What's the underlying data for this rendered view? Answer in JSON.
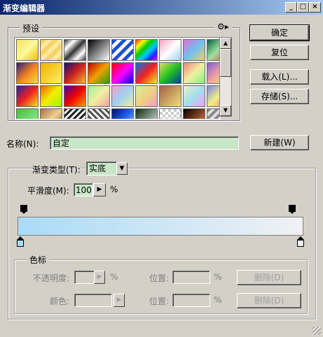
{
  "window": {
    "title": "渐变编辑器",
    "controls": [
      "_",
      "□",
      "×"
    ]
  },
  "buttons": {
    "ok": "确定",
    "reset": "复位",
    "load": "载入(L)...",
    "save": "存储(S)...",
    "new": "新建(W)",
    "delete_opacity": "删除(D)",
    "delete_color": "删除(D)"
  },
  "presets": {
    "label": "预设",
    "menu_icon": "gear-icon",
    "swatches": [
      "linear-gradient(135deg,#f3e35a,#fff7a0,#e8c400)",
      "repeating-linear-gradient(135deg,#f6d365 0 6px,#fde8a0 6px 12px)",
      "linear-gradient(135deg,#333,#fff,#333,#fff,#333)",
      "linear-gradient(135deg,#000,#fff)",
      "repeating-linear-gradient(135deg,#1e50d0 0 5px,#fff 5px 10px)",
      "linear-gradient(135deg,#f22,#ff0,#0c0,#0cf,#22f,#f0f)",
      "linear-gradient(135deg,#f4a0c0,#fff,#a0d0f0)",
      "linear-gradient(135deg,#e070d0,#70c0f0,#f0d060)",
      "linear-gradient(135deg,#0a6040,#a0e0a0,#e04040)",
      "linear-gradient(135deg,#2a1a80,#f08020,#f8e040)",
      "linear-gradient(135deg,#f0b000,#fff060)",
      "linear-gradient(135deg,#101070,#d02020,#f0c020)",
      "linear-gradient(135deg,#c00000,#f0a000,#20a000)",
      "linear-gradient(135deg,#f00,#f0f,#00f)",
      "linear-gradient(135deg,#0070f0,#f02020,#f0f020)",
      "linear-gradient(135deg,#e0e060,#20c020,#0040a0)",
      "linear-gradient(135deg,#f08080,#f0f0a0,#80f080)",
      "linear-gradient(135deg,#8060d0,#f0a0a0,#f0f060)",
      "linear-gradient(135deg,#2020a0,#f02020,#f0e020)",
      "linear-gradient(135deg,#f06000,#f0f000,#a0f000)",
      "linear-gradient(135deg,#4000a0,#f00000,#f0a000)",
      "linear-gradient(135deg,#a0f0a0,#f0f0a0,#f0a0a0)",
      "linear-gradient(135deg,#f0a0d0,#a0d0f0,#f0f0a0)",
      "linear-gradient(135deg,#d0f0a0,#f0d080,#f0a0c0)",
      "linear-gradient(135deg,#a06040,#f0e080)",
      "linear-gradient(135deg,#f0f0c0,#a0e0f0,#f0a0f0)",
      "linear-gradient(135deg,#8080f0,#f0f080,#f08080)",
      "linear-gradient(135deg,#40c040,#a0f0a0)",
      "linear-gradient(135deg,#a07040,#f0d090,#806030)",
      "repeating-linear-gradient(135deg,#222 0 3px,#fff 3px 6px)",
      "repeating-linear-gradient(45deg,#555 0 3px,#fff 3px 6px)",
      "linear-gradient(135deg,#001060,#2060f0,#a0d0ff)",
      "linear-gradient(135deg,#0a3010,#f0f0f0)",
      "repeating-conic-gradient(#ccc 0 25%, #fff 0 50%) 0 0/8px 8px",
      "linear-gradient(135deg,#000,#804020,#f0a060)",
      "repeating-linear-gradient(135deg,#888 0 4px,#ddd 4px 8px)"
    ]
  },
  "name": {
    "label": "名称(N):",
    "value": "自定"
  },
  "gradient": {
    "type_label": "渐变类型(T):",
    "type_value": "实底",
    "smooth_label": "平滑度(M):",
    "smooth_value": "100",
    "smooth_unit": "%",
    "color_start": "#a9dbf7",
    "color_end": "#f1f1f4"
  },
  "stops": {
    "group_label": "色标",
    "opacity_label": "不透明度:",
    "opacity_unit": "%",
    "position_label_1": "位置:",
    "position_unit_1": "%",
    "color_label": "颜色:",
    "position_label_2": "位置:",
    "position_unit_2": "%"
  }
}
